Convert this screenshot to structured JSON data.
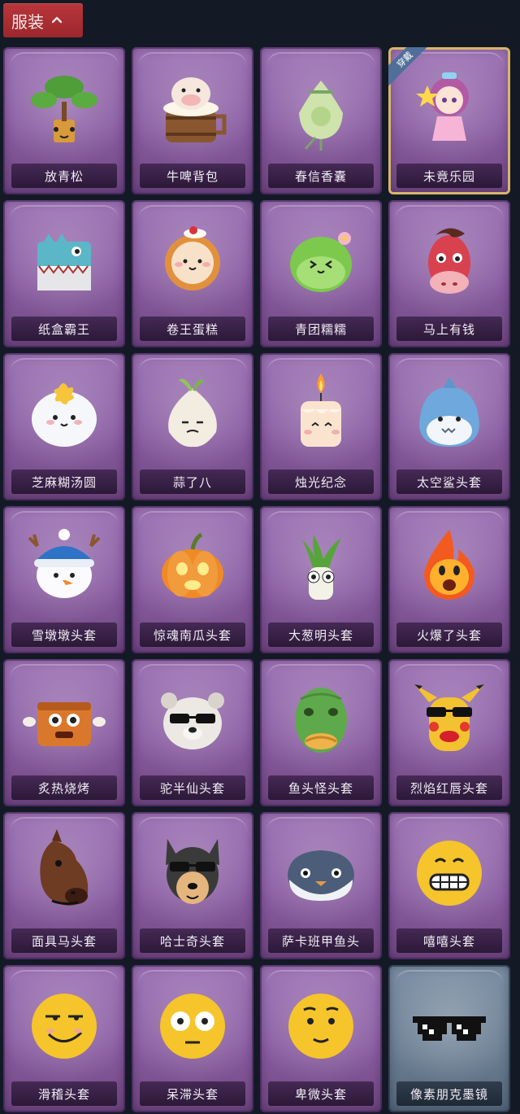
{
  "header": {
    "label": "服装",
    "icon": "chevron-up-icon"
  },
  "items": [
    {
      "name": "放青松",
      "icon": "bonsai-pine-icon"
    },
    {
      "name": "牛啤背包",
      "icon": "cow-beer-barrel-icon"
    },
    {
      "name": "春信香囊",
      "icon": "green-sachet-icon"
    },
    {
      "name": "未竟乐园",
      "icon": "pink-girl-doll-icon",
      "badge": "穿戴",
      "selected": true
    },
    {
      "name": "纸盒霸王",
      "icon": "cardboard-dinosaur-icon"
    },
    {
      "name": "卷王蛋糕",
      "icon": "roll-cake-icon"
    },
    {
      "name": "青团糯糯",
      "icon": "green-rice-ball-icon"
    },
    {
      "name": "马上有钱",
      "icon": "red-horse-head-icon"
    },
    {
      "name": "芝麻糊汤圆",
      "icon": "sesame-dumpling-icon"
    },
    {
      "name": "蒜了八",
      "icon": "garlic-icon"
    },
    {
      "name": "烛光纪念",
      "icon": "candle-icon"
    },
    {
      "name": "太空鲨头套",
      "icon": "shark-head-icon"
    },
    {
      "name": "雪墩墩头套",
      "icon": "snowman-head-icon"
    },
    {
      "name": "惊魂南瓜头套",
      "icon": "pumpkin-head-icon"
    },
    {
      "name": "大葱明头套",
      "icon": "scallion-head-icon"
    },
    {
      "name": "火爆了头套",
      "icon": "fire-head-icon"
    },
    {
      "name": "炙热烧烤",
      "icon": "barbecue-meat-icon"
    },
    {
      "name": "驼半仙头套",
      "icon": "bear-sunglasses-icon"
    },
    {
      "name": "鱼头怪头套",
      "icon": "fish-head-icon"
    },
    {
      "name": "烈焰红唇头套",
      "icon": "yellow-mouse-lips-icon"
    },
    {
      "name": "面具马头套",
      "icon": "horse-mask-icon"
    },
    {
      "name": "哈士奇头套",
      "icon": "husky-sunglasses-icon"
    },
    {
      "name": "萨卡班甲鱼头",
      "icon": "blue-fish-head-icon"
    },
    {
      "name": "嘻嘻头套",
      "icon": "grin-emoji-icon"
    },
    {
      "name": "滑稽头套",
      "icon": "smirk-emoji-icon"
    },
    {
      "name": "呆滞头套",
      "icon": "stare-emoji-icon"
    },
    {
      "name": "卑微头套",
      "icon": "shy-emoji-icon"
    },
    {
      "name": "像素朋克墨镜",
      "icon": "pixel-sunglasses-icon",
      "style": "gray"
    }
  ],
  "colors": {
    "background": "#131a26",
    "header": "#b8363a",
    "card_purple": "#8a5ea2",
    "card_gray": "#6a7d92",
    "selected_border": "#d8b56a",
    "badge": "#4f6f9a"
  }
}
